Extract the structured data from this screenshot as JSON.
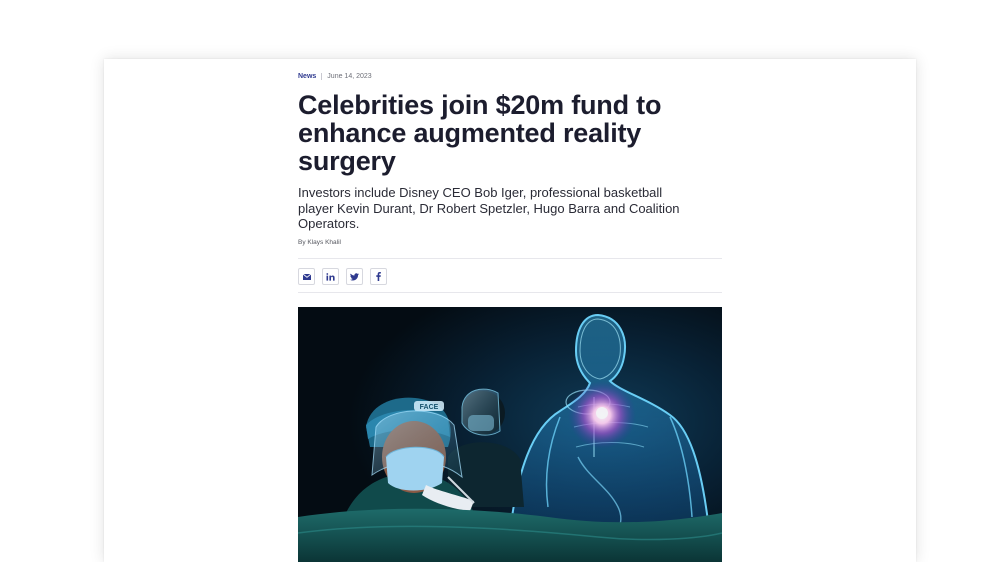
{
  "article": {
    "category": "News",
    "date": "June 14, 2023",
    "headline": "Celebrities join $20m fund to enhance augmented reality surgery",
    "subheadline": "Investors include Disney CEO Bob Iger, professional basketball player Kevin Durant, Dr Robert Spetzler, Hugo Barra and Coalition Operators.",
    "byline": "By Klays Khalil"
  },
  "share": {
    "buttons": [
      {
        "icon": "mail-icon"
      },
      {
        "icon": "linkedin-icon",
        "label": "in"
      },
      {
        "icon": "twitter-icon"
      },
      {
        "icon": "facebook-icon",
        "label": "f"
      }
    ]
  },
  "hero_image": {
    "alt": "Surgeon wearing a mask operating beside a glowing holographic human body",
    "cap_text": "FACE"
  },
  "colors": {
    "accent": "#2f3a8f",
    "headline": "#1c1d2e",
    "hologram": "#1fa8ff"
  }
}
